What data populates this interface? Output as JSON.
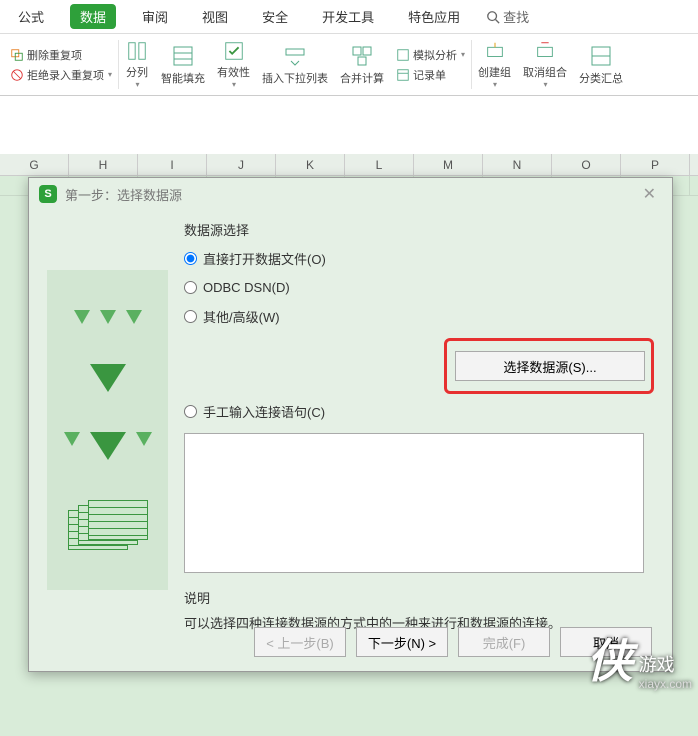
{
  "tabs": {
    "items": [
      "公式",
      "数据",
      "审阅",
      "视图",
      "安全",
      "开发工具",
      "特色应用"
    ],
    "active_index": 1,
    "search_label": "查找"
  },
  "toolbar": {
    "group1": {
      "delete_dup": "删除重复项",
      "reject_dup": "拒绝录入重复项"
    },
    "split": "分列",
    "smart_fill": "智能填充",
    "validity": "有效性",
    "insert_dropdown": "插入下拉列表",
    "consolidate": "合并计算",
    "group4": {
      "scenario": "模拟分析",
      "record_form": "记录单"
    },
    "create_group": "创建组",
    "ungroup": "取消组合",
    "subtotal": "分类汇总"
  },
  "columns": [
    "G",
    "H",
    "I",
    "J",
    "K",
    "L",
    "M",
    "N",
    "O",
    "P"
  ],
  "dialog": {
    "title": "第一步：选择数据源",
    "section_label": "数据源选择",
    "radio_direct": "直接打开数据文件(O)",
    "radio_odbc": "ODBC DSN(D)",
    "radio_other": "其他/高级(W)",
    "radio_manual": "手工输入连接语句(C)",
    "select_btn": "选择数据源(S)...",
    "desc_label": "说明",
    "desc_text": "可以选择四种连接数据源的方式中的一种来进行和数据源的连接。",
    "btn_prev": "< 上一步(B)",
    "btn_next": "下一步(N) >",
    "btn_finish": "完成(F)",
    "btn_cancel": "取消"
  },
  "watermark": {
    "ch": "侠",
    "sub": "游戏",
    "url": "xiayx.com"
  }
}
